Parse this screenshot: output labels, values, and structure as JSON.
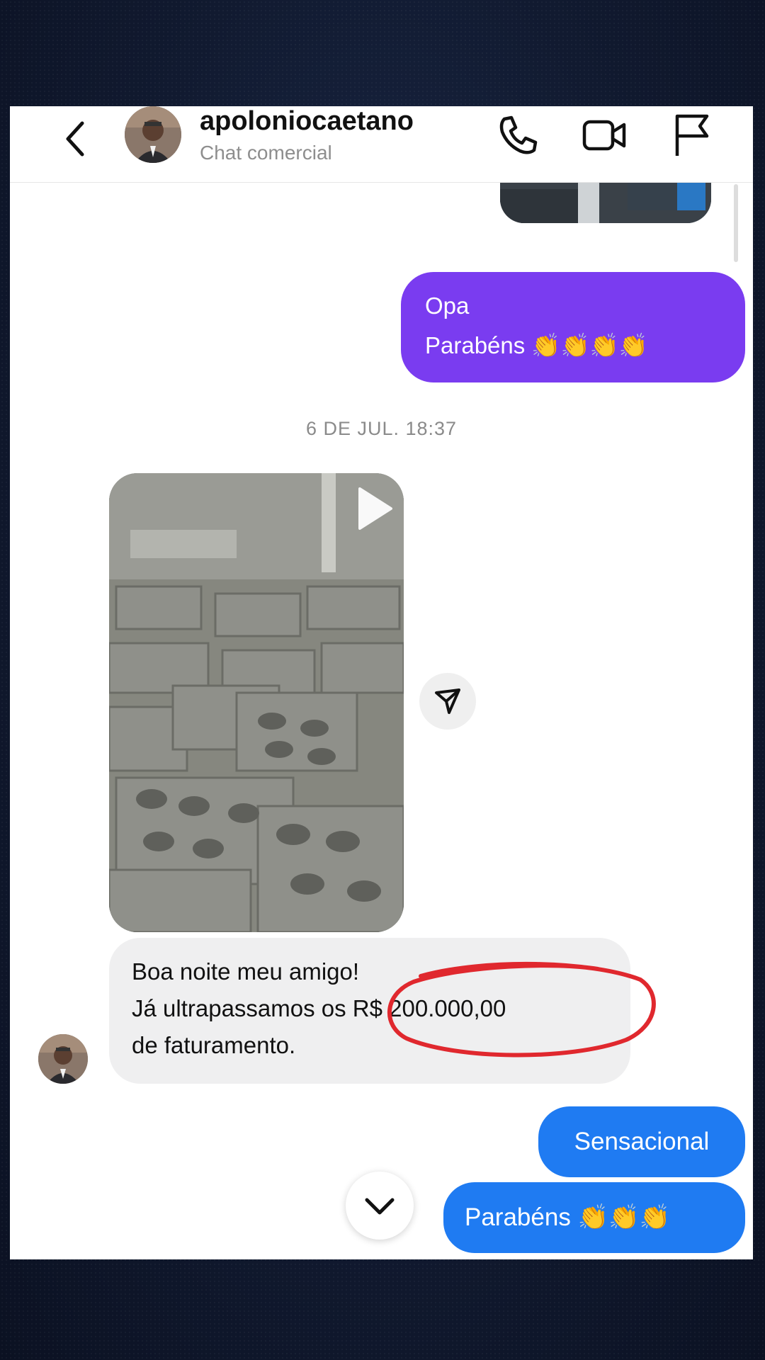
{
  "header": {
    "username": "apoloniocaetano",
    "subtitle": "Chat comercial",
    "icons": [
      "back-icon",
      "phone-icon",
      "video-call-icon",
      "flag-icon"
    ]
  },
  "messages": {
    "sent_1_line1": "Opa",
    "sent_1_line2": "Parabéns 👏👏👏👏",
    "timestamp": "6 DE JUL. 18:37",
    "received_line1": "Boa noite meu amigo!",
    "received_line2": "Já ultrapassamos os R$ 200.000,00",
    "received_line3": "de faturamento.",
    "sent_2": "Sensacional",
    "sent_3": "Parabéns 👏👏👏"
  },
  "colors": {
    "purple_bubble": "#7a3cf0",
    "blue_bubble": "#1f7bf2",
    "gray_bubble": "#efeff0",
    "annotation_red": "#e0282e"
  }
}
